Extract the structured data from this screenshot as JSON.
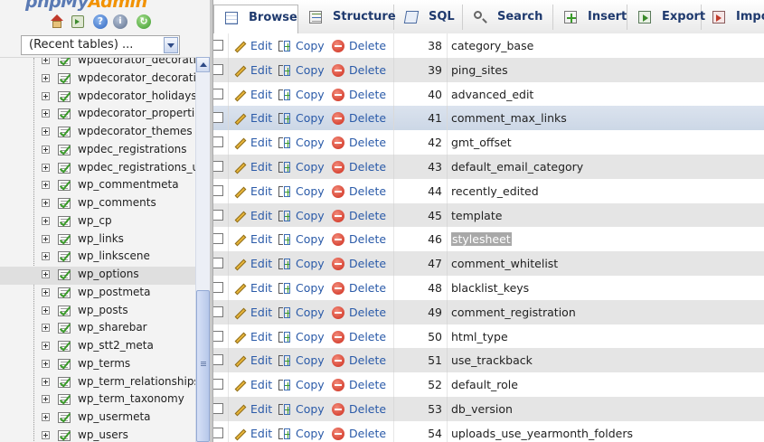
{
  "app": {
    "logo_main": "phpMy",
    "logo_accent": "Admin"
  },
  "nav_icons": [
    "home-icon",
    "exit-icon",
    "help-icon",
    "docs-icon",
    "reload-icon"
  ],
  "recent": {
    "label": "(Recent tables) ..."
  },
  "tables": [
    {
      "name": "wpdecorator_decorati"
    },
    {
      "name": "wpdecorator_decoratic"
    },
    {
      "name": "wpdecorator_holidays"
    },
    {
      "name": "wpdecorator_propertie"
    },
    {
      "name": "wpdecorator_themes"
    },
    {
      "name": "wpdec_registrations"
    },
    {
      "name": "wpdec_registrations_u"
    },
    {
      "name": "wp_commentmeta"
    },
    {
      "name": "wp_comments"
    },
    {
      "name": "wp_cp"
    },
    {
      "name": "wp_links"
    },
    {
      "name": "wp_linkscene"
    },
    {
      "name": "wp_options",
      "selected": true
    },
    {
      "name": "wp_postmeta"
    },
    {
      "name": "wp_posts"
    },
    {
      "name": "wp_sharebar"
    },
    {
      "name": "wp_stt2_meta"
    },
    {
      "name": "wp_terms"
    },
    {
      "name": "wp_term_relationships"
    },
    {
      "name": "wp_term_taxonomy"
    },
    {
      "name": "wp_usermeta"
    },
    {
      "name": "wp_users"
    }
  ],
  "tabs": [
    {
      "label": "Browse",
      "icon": "browse-icon",
      "active": true
    },
    {
      "label": "Structure",
      "icon": "structure-icon"
    },
    {
      "label": "SQL",
      "icon": "sql-icon"
    },
    {
      "label": "Search",
      "icon": "search-icon"
    },
    {
      "label": "Insert",
      "icon": "insert-icon"
    },
    {
      "label": "Export",
      "icon": "export-icon"
    },
    {
      "label": "Impo",
      "icon": "import-icon"
    }
  ],
  "actions": {
    "edit": "Edit",
    "copy": "Copy",
    "delete": "Delete"
  },
  "rows": [
    {
      "id": "38",
      "value": "category_base"
    },
    {
      "id": "39",
      "value": "ping_sites"
    },
    {
      "id": "40",
      "value": "advanced_edit"
    },
    {
      "id": "41",
      "value": "comment_max_links",
      "marked": true
    },
    {
      "id": "42",
      "value": "gmt_offset"
    },
    {
      "id": "43",
      "value": "default_email_category"
    },
    {
      "id": "44",
      "value": "recently_edited"
    },
    {
      "id": "45",
      "value": "template"
    },
    {
      "id": "46",
      "value": "stylesheet",
      "highlight": true
    },
    {
      "id": "47",
      "value": "comment_whitelist"
    },
    {
      "id": "48",
      "value": "blacklist_keys"
    },
    {
      "id": "49",
      "value": "comment_registration"
    },
    {
      "id": "50",
      "value": "html_type"
    },
    {
      "id": "51",
      "value": "use_trackback"
    },
    {
      "id": "52",
      "value": "default_role"
    },
    {
      "id": "53",
      "value": "db_version"
    },
    {
      "id": "54",
      "value": "uploads_use_yearmonth_folders"
    }
  ]
}
